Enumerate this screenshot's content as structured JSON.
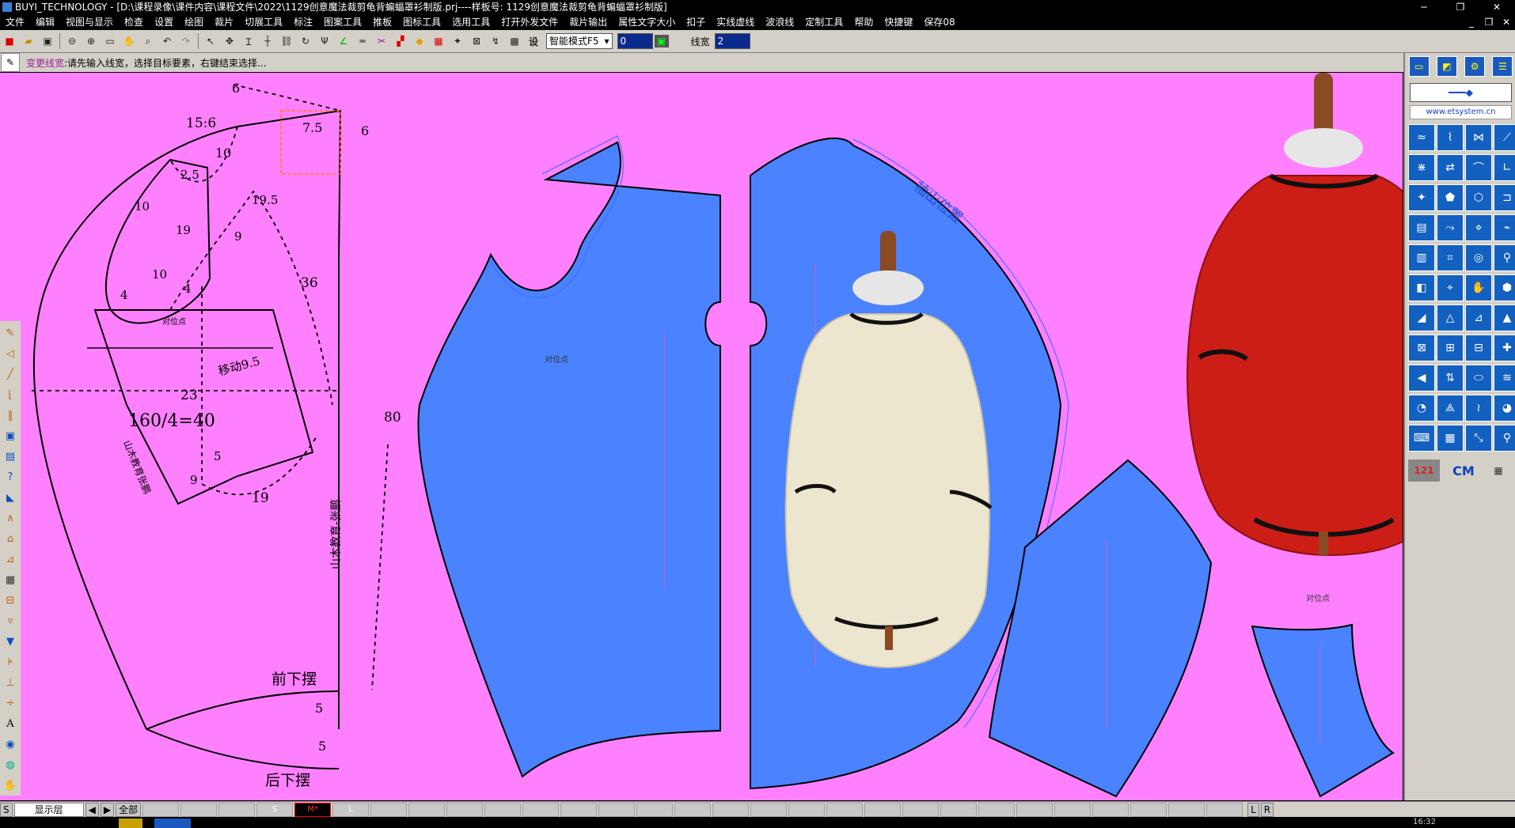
{
  "window": {
    "title": "BUYI_TECHNOLOGY - [D:\\课程录像\\课件内容\\课程文件\\2022\\1129创意魔法裁剪龟背蝙蝠罩衫制版.prj----样板号: 1129创意魔法裁剪龟背蝙蝠罩衫制版]",
    "minimize": "─",
    "restore": "❐",
    "close": "✕"
  },
  "menu": {
    "items": [
      "文件",
      "编辑",
      "视图与显示",
      "检查",
      "设置",
      "绘图",
      "裁片",
      "切展工具",
      "标注",
      "图案工具",
      "推板",
      "图标工具",
      "选用工具",
      "打开外发文件",
      "裁片输出",
      "属性文字大小",
      "扣子",
      "实线虚线",
      "波浪线",
      "定制工具",
      "帮助",
      "快捷键",
      "保存08"
    ],
    "mdi_min": "_",
    "mdi_restore": "❐",
    "mdi_close": "✕"
  },
  "toolbar": {
    "icons": [
      "new-file-icon",
      "open-folder-icon",
      "save-icon",
      "zoom-out-icon",
      "zoom-in-icon",
      "zoom-window-icon",
      "pan-hand-icon",
      "zoom-fit-icon",
      "undo-icon",
      "redo-icon",
      "select-arrow-icon",
      "move-icon",
      "text-i-icon",
      "crosshair-icon",
      "chain-icon",
      "rotate-icon",
      "fork-icon",
      "angle-icon",
      "double-line-icon",
      "scissors-icon",
      "ruler-icon",
      "color-icon",
      "grid-icon",
      "dart-icon",
      "measure-icon",
      "layer-icon",
      "frame-icon"
    ],
    "settings_label": "设",
    "mode": "智能模式F5",
    "value_input": "0",
    "line_width_label": "线宽",
    "line_width_value": "2"
  },
  "prompt": {
    "command": "变更线宽",
    "message": ":请先输入线宽，选择目标要素，右键结束选择..."
  },
  "pattern": {
    "labels": {
      "m6a": "6",
      "m156": "15:6",
      "m75": "7.5",
      "m6b": "6",
      "m10a": "10",
      "m25": "2.5",
      "m195": "19.5",
      "m10b": "10",
      "m19a": "19",
      "m9a": "9",
      "m36": "36",
      "m10c": "10",
      "m4a": "4",
      "m4b": "4",
      "align1": "对位点",
      "move95": "移动9.5",
      "m23": "23",
      "m80": "80",
      "chest": "160/4=40",
      "school1": "山木教育张鹏",
      "m5a": "5",
      "m9b": "9",
      "m19b": "19",
      "school2": "山木教育-张鹏",
      "front_hem": "前下摆",
      "m5b": "5",
      "m5c": "5",
      "back_hem": "后下摆",
      "align2": "对位点",
      "sleeve_cap": "袖山位置",
      "align3": "对位点"
    }
  },
  "status": {
    "s": "S",
    "layer": "显示层",
    "prev": "◀",
    "next": "▶",
    "all": "全部",
    "size_s": "S",
    "size_m": "M*",
    "size_l": "L",
    "left": "L",
    "right": "R"
  },
  "right_panel": {
    "website": "www.etsystem.cn",
    "counter": "121",
    "unit": "CM"
  },
  "taskbar": {
    "clock": "16:32"
  },
  "colors": {
    "canvas": "#ff80ff",
    "piece": "#4a82ff",
    "garment_white": "#ece6cf",
    "garment_red": "#cc1e16"
  }
}
